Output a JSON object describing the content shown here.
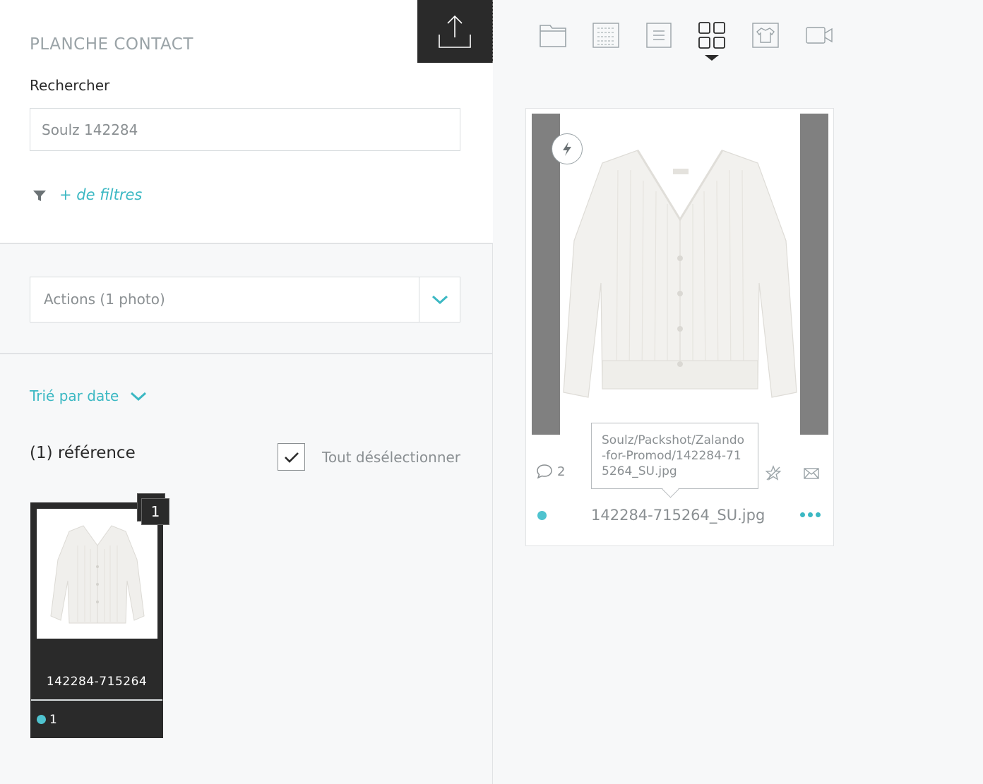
{
  "panel": {
    "title": "PLANCHE CONTACT",
    "search_label": "Rechercher",
    "search_value": "Soulz 142284",
    "filters_link": "+ de filtres",
    "actions_label": "Actions (1 photo)",
    "sort_label": "Trié par date",
    "ref_count": "(1) référence",
    "deselect_label": "Tout désélectionner"
  },
  "reference_card": {
    "badge": "1",
    "name": "142284-715264",
    "dot_count": "1",
    "dot_color": "#4fc3cf"
  },
  "view_icons": [
    "folder-icon",
    "grid-list-icon",
    "list-icon",
    "grid-icon",
    "shirt-icon",
    "video-icon"
  ],
  "photo_card": {
    "comment_count": "2",
    "tooltip": "Soulz/Packshot/Zalando-for-Promod/142284-715264_SU.jpg",
    "filename": "142284-715264_SU.jpg"
  },
  "colors": {
    "accent": "#3bb8c3",
    "dark": "#2a2a2a",
    "status_dot": "#4fc3cf"
  }
}
